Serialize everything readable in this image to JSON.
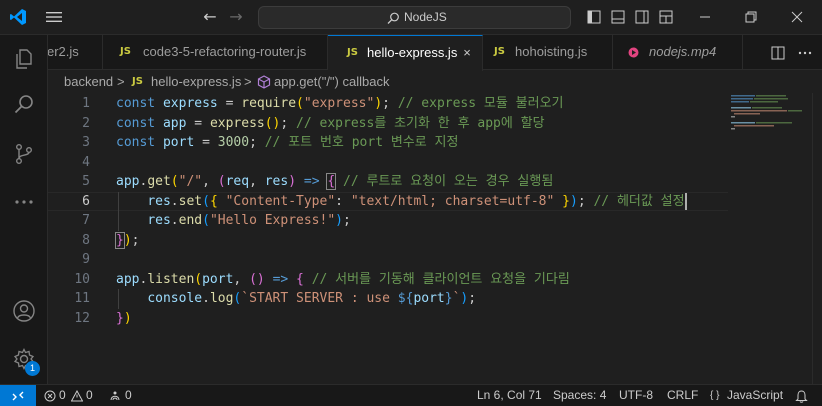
{
  "titlebar": {
    "search_label": "NodeJS",
    "accent": "#0078d4"
  },
  "tabs": [
    {
      "label": "er2.js",
      "icon": "JS"
    },
    {
      "label": "code3-5-refactoring-router.js",
      "icon": "JS"
    },
    {
      "label": "hello-express.js",
      "icon": "JS",
      "active": true,
      "close": "×"
    },
    {
      "label": "hohoisting.js",
      "icon": "JS"
    },
    {
      "label": "nodejs.mp4",
      "icon": "video-icon"
    }
  ],
  "breadcrumb": {
    "folder": "backend",
    "file_icon": "JS",
    "file": "hello-express.js",
    "symbol": "app.get(\"/\") callback",
    "separator": ">"
  },
  "editor": {
    "line_numbers": [
      "1",
      "2",
      "3",
      "4",
      "5",
      "6",
      "7",
      "8",
      "9",
      "10",
      "11",
      "12"
    ],
    "current_line": 6,
    "lines": [
      [
        [
          "kw",
          "const"
        ],
        [
          "p",
          " "
        ],
        [
          "v",
          "express"
        ],
        [
          "p",
          " = "
        ],
        [
          "fn",
          "require"
        ],
        [
          "b1",
          "("
        ],
        [
          "str",
          "\"express\""
        ],
        [
          "b1",
          ")"
        ],
        [
          "p",
          "; "
        ],
        [
          "cm",
          "// express 모듈 불러오기"
        ]
      ],
      [
        [
          "kw",
          "const"
        ],
        [
          "p",
          " "
        ],
        [
          "v",
          "app"
        ],
        [
          "p",
          " = "
        ],
        [
          "fn",
          "express"
        ],
        [
          "b1",
          "()"
        ],
        [
          "p",
          "; "
        ],
        [
          "cm",
          "// express를 초기화 한 후 app에 할당"
        ]
      ],
      [
        [
          "kw",
          "const"
        ],
        [
          "p",
          " "
        ],
        [
          "v",
          "port"
        ],
        [
          "p",
          " = "
        ],
        [
          "num",
          "3000"
        ],
        [
          "p",
          "; "
        ],
        [
          "cm",
          "// 포트 번호 port 변수로 지정"
        ]
      ],
      [],
      [
        [
          "v",
          "app"
        ],
        [
          "p",
          "."
        ],
        [
          "fn",
          "get"
        ],
        [
          "b1",
          "("
        ],
        [
          "str",
          "\"/\""
        ],
        [
          "p",
          ", "
        ],
        [
          "b2",
          "("
        ],
        [
          "v",
          "req"
        ],
        [
          "p",
          ", "
        ],
        [
          "v",
          "res"
        ],
        [
          "b2",
          ")"
        ],
        [
          "p",
          " "
        ],
        [
          "kw",
          "=>"
        ],
        [
          "p",
          " "
        ],
        [
          "b2",
          "{"
        ],
        [
          "p",
          " "
        ],
        [
          "cm",
          "// 루트로 요청이 오는 경우 실행됨"
        ]
      ],
      [
        [
          "p",
          "    "
        ],
        [
          "v",
          "res"
        ],
        [
          "p",
          "."
        ],
        [
          "fn",
          "set"
        ],
        [
          "b3",
          "("
        ],
        [
          "b1",
          "{"
        ],
        [
          "p",
          " "
        ],
        [
          "str",
          "\"Content-Type\""
        ],
        [
          "p",
          ": "
        ],
        [
          "str",
          "\"text/html; charset=utf-8\""
        ],
        [
          "p",
          " "
        ],
        [
          "b1",
          "}"
        ],
        [
          "b3",
          ")"
        ],
        [
          "p",
          "; "
        ],
        [
          "cm",
          "// 헤더값 설정"
        ]
      ],
      [
        [
          "p",
          "    "
        ],
        [
          "v",
          "res"
        ],
        [
          "p",
          "."
        ],
        [
          "fn",
          "end"
        ],
        [
          "b3",
          "("
        ],
        [
          "str",
          "\"Hello Express!\""
        ],
        [
          "b3",
          ")"
        ],
        [
          "p",
          ";"
        ]
      ],
      [
        [
          "b2",
          "}"
        ],
        [
          "b1",
          ")"
        ],
        [
          "p",
          ";"
        ]
      ],
      [],
      [
        [
          "v",
          "app"
        ],
        [
          "p",
          "."
        ],
        [
          "fn",
          "listen"
        ],
        [
          "b1",
          "("
        ],
        [
          "v",
          "port"
        ],
        [
          "p",
          ", "
        ],
        [
          "b2",
          "()"
        ],
        [
          "p",
          " "
        ],
        [
          "kw",
          "=>"
        ],
        [
          "p",
          " "
        ],
        [
          "b2",
          "{"
        ],
        [
          "p",
          " "
        ],
        [
          "cm",
          "// 서버를 기동해 클라이언트 요청을 기다림"
        ]
      ],
      [
        [
          "p",
          "    "
        ],
        [
          "v",
          "console"
        ],
        [
          "p",
          "."
        ],
        [
          "fn",
          "log"
        ],
        [
          "b3",
          "("
        ],
        [
          "tpl",
          "`START SERVER : use "
        ],
        [
          "kw",
          "${"
        ],
        [
          "v",
          "port"
        ],
        [
          "kw",
          "}"
        ],
        [
          "tpl",
          "`"
        ],
        [
          "b3",
          ")"
        ],
        [
          "p",
          ";"
        ]
      ],
      [
        [
          "b2",
          "}"
        ],
        [
          "b1",
          ")"
        ]
      ]
    ]
  },
  "statusbar": {
    "errors": "0",
    "warnings": "0",
    "ports": "0",
    "position": "Ln 6, Col 71",
    "spaces": "Spaces: 4",
    "encoding": "UTF-8",
    "eol": "CRLF",
    "language_icon": "{ }",
    "language": "JavaScript"
  },
  "activity": {
    "settings_badge": "1"
  }
}
